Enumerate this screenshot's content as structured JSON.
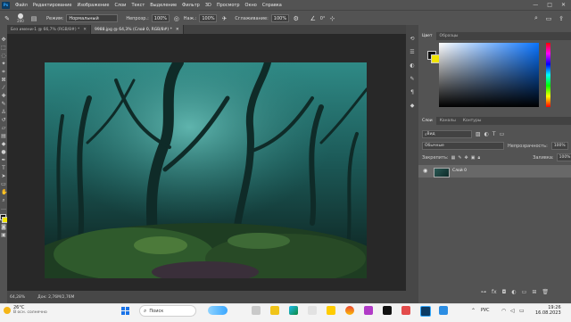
{
  "menu": {
    "app_icon": "Ps",
    "items": [
      "Файл",
      "Редактирование",
      "Изображение",
      "Слои",
      "Текст",
      "Выделение",
      "Фильтр",
      "3D",
      "Просмотр",
      "Окно",
      "Справка"
    ],
    "window_controls": [
      "—",
      "□",
      "✕"
    ]
  },
  "options": {
    "brush_size": "200",
    "mode_label": "Режим:",
    "mode_value": "Нормальный",
    "opacity_label": "Непрозр.:",
    "opacity_value": "100%",
    "pressure_label": "Наж.:",
    "pressure_value": "100%",
    "smoothing_label": "Сглаживание:",
    "smoothing_value": "100%",
    "angle_value": "0°"
  },
  "tabs": [
    {
      "label": "Без имени-1 @ 66,7% (RGB/8#) *",
      "active": false
    },
    {
      "label": "9988.jpg @ 64,3% (Слой 0, RGB/8#) *",
      "active": true
    }
  ],
  "status": {
    "zoom": "64,28%",
    "doc": "Док: 2,76M/2,76M"
  },
  "color_panel": {
    "tabs": [
      "Цвет",
      "Образцы"
    ],
    "fg_color": "#111111",
    "bg_color": "#f2e500"
  },
  "layers_panel": {
    "tabs": [
      "Слои",
      "Каналы",
      "Контуры"
    ],
    "filter_label": "Вид",
    "blend_mode": "Обычные",
    "opacity_label": "Непрозрачность:",
    "opacity_value": "100%",
    "lock_label": "Закрепить:",
    "fill_label": "Заливка:",
    "fill_value": "100%",
    "layers": [
      {
        "name": "Слой 0"
      }
    ]
  },
  "taskbar": {
    "weather_temp": "26°C",
    "weather_text": "В осн. солнечно",
    "search_placeholder": "Поиск",
    "language": "РУС",
    "time": "19:26",
    "date": "16.08.2023"
  }
}
